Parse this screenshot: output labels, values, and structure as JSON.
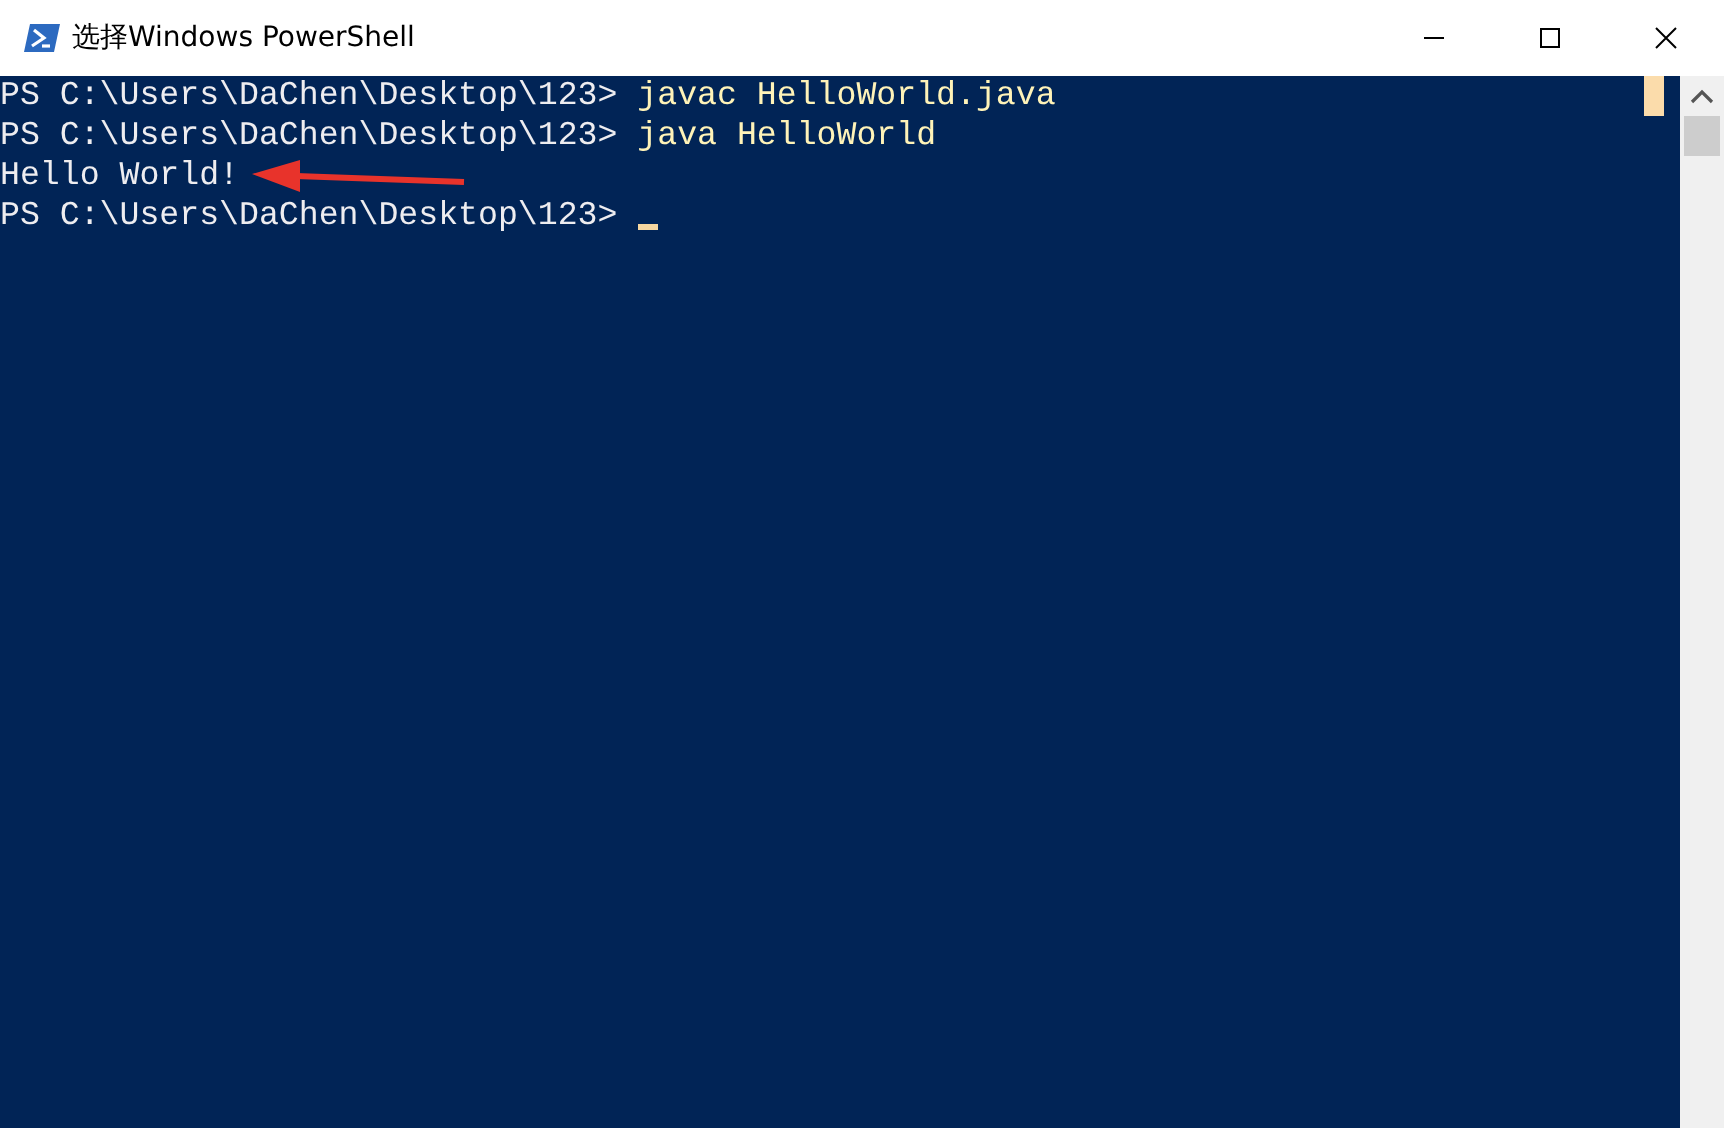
{
  "window": {
    "title": "选择Windows PowerShell"
  },
  "console": {
    "lines": [
      {
        "cursor": false,
        "segments": [
          {
            "kind": "prompt",
            "text": "PS C:\\Users\\DaChen\\Desktop\\123> "
          },
          {
            "kind": "command",
            "text": "javac HelloWorld.java"
          }
        ]
      },
      {
        "cursor": false,
        "segments": [
          {
            "kind": "prompt",
            "text": "PS C:\\Users\\DaChen\\Desktop\\123> "
          },
          {
            "kind": "command",
            "text": "java HelloWorld"
          }
        ]
      },
      {
        "cursor": false,
        "segments": [
          {
            "kind": "output",
            "text": "Hello World!"
          }
        ]
      },
      {
        "cursor": true,
        "segments": [
          {
            "kind": "prompt",
            "text": "PS C:\\Users\\DaChen\\Desktop\\123> "
          }
        ]
      }
    ]
  }
}
